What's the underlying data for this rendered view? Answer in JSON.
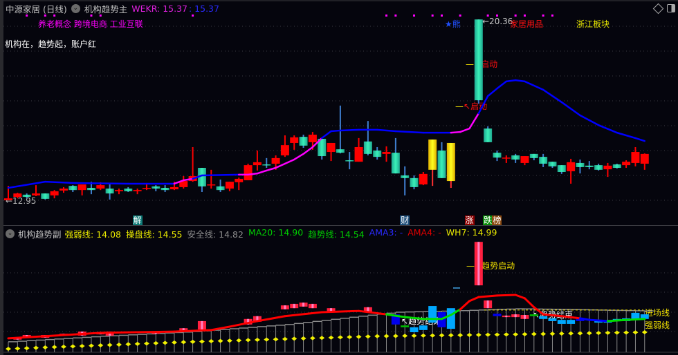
{
  "header": {
    "stock_name": "中源家居 (日线)",
    "main_indicator": "机构趋势主",
    "wekr_label": "WEKR: 15.37",
    "wekr_value2": ": 15.37",
    "icons": [
      "chevron-circle-icon",
      "diamond-icon",
      "panel-toggle-icon"
    ]
  },
  "concept_tags": "养老概念 跨境电商 工业互联",
  "slogan": "机构在，趋势起，账户红",
  "annotations": {
    "low_price": "←12.95",
    "high_price": "←20.36",
    "bear": "★熊",
    "industry": "家居用品",
    "region": "浙江板块",
    "start1": "启动",
    "start2": "启动"
  },
  "event_badges": [
    {
      "text": "解",
      "index": 14,
      "color": "#0d7a77"
    },
    {
      "text": "财",
      "index": 43,
      "color": "#1d4e7a"
    },
    {
      "text": "涨",
      "index": 50,
      "color": "#8b0000"
    },
    {
      "text": "跌",
      "index": 52,
      "color": "#0a8a0a"
    },
    {
      "text": "榜",
      "index": 53,
      "color": "#8b4a10"
    }
  ],
  "sub_header": {
    "name": "机构趋势副",
    "items": [
      {
        "label": "强弱线: 14.08",
        "color": "#e8e800"
      },
      {
        "label": "操盘线: 14.55",
        "color": "#e8e800"
      },
      {
        "label": "安全线: 14.82",
        "color": "#8c8c8c"
      },
      {
        "label": "MA20: 14.90",
        "color": "#00d000"
      },
      {
        "label": "趋势线: 14.54",
        "color": "#00d000"
      },
      {
        "label": "AMA3: -",
        "color": "#2a2aff"
      },
      {
        "label": "AMA4: -",
        "color": "#e00000"
      },
      {
        "label": "WH7: 14.99",
        "color": "#e8e800"
      }
    ]
  },
  "sub_annotations": {
    "trend_start": "趋势启动",
    "trend_end1": "趋势结束",
    "trend_end2": "趋势结束",
    "entry_line": "进场线",
    "strength_line": "强弱线"
  },
  "colors": {
    "up": "#ff0000",
    "down": "#2ee8b0",
    "special": "#f0e000",
    "ma": "#0000ff",
    "ma_rise": "#ff00ff"
  },
  "chart_data": {
    "type": "candlestick",
    "yellow_indices": [
      46,
      48
    ],
    "signal_dots": [
      2,
      4,
      5,
      9,
      10,
      20,
      41,
      42,
      44,
      46,
      47,
      49,
      52,
      53,
      55,
      56,
      58,
      59
    ],
    "candles": [
      [
        12.95,
        13.54,
        12.95,
        13.03
      ],
      [
        13.09,
        13.26,
        13.03,
        13.23
      ],
      [
        13.18,
        13.23,
        13.03,
        13.09
      ],
      [
        13.15,
        13.57,
        13.12,
        13.23
      ],
      [
        13.23,
        13.23,
        12.98,
        13.01
      ],
      [
        13.15,
        13.37,
        13.03,
        13.32
      ],
      [
        13.35,
        13.49,
        13.26,
        13.43
      ],
      [
        13.54,
        13.57,
        13.29,
        13.37
      ],
      [
        13.37,
        13.6,
        13.15,
        13.6
      ],
      [
        13.46,
        13.71,
        13.2,
        13.37
      ],
      [
        13.43,
        13.69,
        13.37,
        13.57
      ],
      [
        13.43,
        13.6,
        12.98,
        13.23
      ],
      [
        13.32,
        13.43,
        13.2,
        13.37
      ],
      [
        13.43,
        13.49,
        13.29,
        13.32
      ],
      [
        13.32,
        13.43,
        13.2,
        13.37
      ],
      [
        13.43,
        13.66,
        13.37,
        13.46
      ],
      [
        13.52,
        13.57,
        13.32,
        13.43
      ],
      [
        13.46,
        13.57,
        13.29,
        13.37
      ],
      [
        13.4,
        13.71,
        13.37,
        13.49
      ],
      [
        13.49,
        13.94,
        13.43,
        13.74
      ],
      [
        13.74,
        15.13,
        13.71,
        13.94
      ],
      [
        14.28,
        14.28,
        13.29,
        13.52
      ],
      [
        13.57,
        14.2,
        13.43,
        13.6
      ],
      [
        13.52,
        13.8,
        13.29,
        13.37
      ],
      [
        13.43,
        13.71,
        13.32,
        13.71
      ],
      [
        13.69,
        13.88,
        13.37,
        13.83
      ],
      [
        13.77,
        14.45,
        13.77,
        14.39
      ],
      [
        14.39,
        14.99,
        14.17,
        14.51
      ],
      [
        14.42,
        14.68,
        14.28,
        14.39
      ],
      [
        14.45,
        14.79,
        14.2,
        14.68
      ],
      [
        14.79,
        15.61,
        14.73,
        15.21
      ],
      [
        15.3,
        15.61,
        15.02,
        15.53
      ],
      [
        15.55,
        15.64,
        15.1,
        15.19
      ],
      [
        15.33,
        15.75,
        15.02,
        15.64
      ],
      [
        15.47,
        15.47,
        14.62,
        14.76
      ],
      [
        14.93,
        15.3,
        14.56,
        15.3
      ],
      [
        15.04,
        16.83,
        14.87,
        14.9
      ],
      [
        14.59,
        14.93,
        14.22,
        14.56
      ],
      [
        14.53,
        15.5,
        14.53,
        15.13
      ],
      [
        15.36,
        16.2,
        14.79,
        14.85
      ],
      [
        14.99,
        15.13,
        14.62,
        14.73
      ],
      [
        14.85,
        15.16,
        14.53,
        14.93
      ],
      [
        14.9,
        15.5,
        14.05,
        14.05
      ],
      [
        13.97,
        14.34,
        13.15,
        13.86
      ],
      [
        13.86,
        13.97,
        13.4,
        13.49
      ],
      [
        13.6,
        14.11,
        13.57,
        14.03
      ],
      [
        14.2,
        15.44,
        13.54,
        15.44
      ],
      [
        14.99,
        15.33,
        13.86,
        13.86
      ],
      [
        13.74,
        15.3,
        13.46,
        15.3
      ],
      null,
      null,
      [
        20.36,
        20.36,
        16.91,
        17.05
      ],
      [
        15.89,
        15.98,
        15.33,
        15.33
      ],
      [
        14.9,
        14.99,
        14.56,
        14.7
      ],
      [
        14.68,
        14.79,
        14.48,
        14.7
      ],
      [
        14.79,
        14.85,
        14.48,
        14.62
      ],
      [
        14.48,
        14.76,
        14.39,
        14.76
      ],
      [
        14.85,
        14.85,
        14.59,
        14.68
      ],
      [
        14.73,
        14.85,
        14.31,
        14.45
      ],
      [
        14.53,
        14.53,
        14.28,
        14.34
      ],
      [
        14.39,
        14.39,
        14.03,
        14.11
      ],
      [
        14.14,
        14.65,
        13.63,
        14.51
      ],
      [
        14.48,
        14.62,
        14.05,
        14.31
      ],
      [
        14.37,
        14.56,
        14.22,
        14.31
      ],
      [
        14.39,
        14.45,
        14.17,
        14.2
      ],
      [
        14.22,
        14.48,
        13.91,
        14.37
      ],
      [
        14.42,
        14.45,
        14.25,
        14.28
      ],
      [
        14.39,
        14.59,
        14.28,
        14.53
      ],
      [
        14.48,
        15.13,
        14.34,
        14.93
      ],
      [
        14.45,
        14.87,
        14.2,
        14.85
      ]
    ],
    "ma_line": [
      [
        0,
        13.46,
        "ma"
      ],
      [
        4,
        13.71,
        "ma"
      ],
      [
        7,
        13.66,
        "ma"
      ],
      [
        13,
        13.63,
        "ma"
      ],
      [
        18,
        13.63,
        "ma"
      ],
      [
        19,
        13.77,
        "ma_rise"
      ],
      [
        20,
        13.83,
        "ma_rise"
      ],
      [
        21,
        13.97,
        "ma"
      ],
      [
        25,
        14.0,
        "ma"
      ],
      [
        26,
        14.0,
        "ma_rise"
      ],
      [
        27,
        14.05,
        "ma_rise"
      ],
      [
        28,
        14.17,
        "ma_rise"
      ],
      [
        29,
        14.28,
        "ma_rise"
      ],
      [
        30,
        14.45,
        "ma_rise"
      ],
      [
        31,
        14.62,
        "ma_rise"
      ],
      [
        32,
        14.85,
        "ma_rise"
      ],
      [
        33,
        15.13,
        "ma_rise"
      ],
      [
        34,
        15.5,
        "ma_rise"
      ],
      [
        35,
        15.78,
        "ma"
      ],
      [
        36,
        15.81,
        "ma"
      ],
      [
        38,
        15.84,
        "ma"
      ],
      [
        40,
        15.84,
        "ma"
      ],
      [
        42,
        15.78,
        "ma"
      ],
      [
        45,
        15.72,
        "ma"
      ],
      [
        48,
        15.72,
        "ma"
      ],
      [
        49,
        15.75,
        "ma_rise"
      ],
      [
        50,
        15.89,
        "ma_rise"
      ],
      [
        51,
        16.51,
        "ma_rise"
      ],
      [
        52,
        17.22,
        "ma"
      ],
      [
        53,
        17.53,
        "ma"
      ],
      [
        54,
        17.82,
        "ma"
      ],
      [
        55,
        17.87,
        "ma"
      ],
      [
        56,
        17.82,
        "ma"
      ],
      [
        58,
        17.48,
        "ma"
      ],
      [
        60,
        16.97,
        "ma"
      ],
      [
        62,
        16.43,
        "ma"
      ],
      [
        64,
        16.03,
        "ma"
      ],
      [
        66,
        15.72,
        "ma"
      ],
      [
        68,
        15.5,
        "ma"
      ],
      [
        69,
        15.38,
        "ma"
      ]
    ],
    "sub_trend_line": [
      [
        0,
        13.88,
        "#ff0000"
      ],
      [
        4,
        13.95,
        "#ff0000"
      ],
      [
        10,
        14.06,
        "#ff0000"
      ],
      [
        18,
        14.1,
        "#ff0000"
      ],
      [
        22,
        14.15,
        "#ff0000"
      ],
      [
        24,
        14.26,
        "#ff0000"
      ],
      [
        27,
        14.44,
        "#ff0000"
      ],
      [
        30,
        14.6,
        "#ff0000"
      ],
      [
        34,
        14.73,
        "#ff0000"
      ],
      [
        38,
        14.77,
        "#ff0000"
      ],
      [
        41,
        14.66,
        "#ff0000"
      ],
      [
        43,
        14.57,
        "#00dd00"
      ],
      [
        45,
        14.51,
        "#00dd00"
      ],
      [
        47,
        14.51,
        "#00dd00"
      ],
      [
        48,
        14.64,
        "#00dd00"
      ],
      [
        49,
        14.82,
        "#00dd00"
      ],
      [
        50,
        15.09,
        "#ff0000"
      ],
      [
        51,
        15.22,
        "#ff0000"
      ],
      [
        53,
        15.27,
        "#ff0000"
      ],
      [
        55,
        15.29,
        "#ff0000"
      ],
      [
        56,
        15.18,
        "#ff0000"
      ],
      [
        57,
        14.89,
        "#ff0000"
      ],
      [
        58,
        14.66,
        "#ff0000"
      ],
      [
        60,
        14.6,
        "#ff0000"
      ],
      [
        62,
        14.53,
        "#ff0000"
      ],
      [
        63,
        14.48,
        "#0000ff"
      ],
      [
        65,
        14.44,
        "#0000ff"
      ],
      [
        66,
        14.46,
        "#00dd00"
      ],
      [
        69,
        14.51,
        "#00dd00"
      ]
    ],
    "safety_line": [
      [
        0,
        13.77
      ],
      [
        10,
        13.95
      ],
      [
        20,
        14.1
      ],
      [
        30,
        14.33
      ],
      [
        38,
        14.6
      ],
      [
        42,
        14.73
      ],
      [
        48,
        14.77
      ],
      [
        55,
        14.84
      ],
      [
        60,
        14.82
      ],
      [
        69,
        14.77
      ]
    ],
    "strength_line": [
      [
        0,
        13.54
      ],
      [
        20,
        13.77
      ],
      [
        40,
        13.95
      ],
      [
        55,
        14.01
      ],
      [
        69,
        14.08
      ]
    ],
    "entry_line_value": 14.8,
    "sub_bars": [
      [
        1,
        13.9,
        13.84,
        "#ff2040"
      ],
      [
        2,
        13.99,
        13.93,
        "#ff2040"
      ],
      [
        4,
        13.99,
        13.9,
        "#ff2040"
      ],
      [
        6,
        14.03,
        13.99,
        "#ff2040"
      ],
      [
        8,
        14.1,
        13.97,
        "#ff2040"
      ],
      [
        10,
        14.06,
        14.01,
        "#ff2040"
      ],
      [
        11,
        14.1,
        13.97,
        "#ff2040"
      ],
      [
        16,
        14.1,
        14.03,
        "#ff2040"
      ],
      [
        19,
        14.21,
        14.1,
        "#ff2040"
      ],
      [
        21,
        14.44,
        14.17,
        "#ff2040"
      ],
      [
        26,
        14.51,
        14.33,
        "#ff2040"
      ],
      [
        27,
        14.6,
        14.42,
        "#ff2040"
      ],
      [
        30,
        14.95,
        14.82,
        "#ff2040"
      ],
      [
        31,
        15.0,
        14.86,
        "#ff2040"
      ],
      [
        32,
        15.04,
        14.91,
        "#ff2040"
      ],
      [
        33,
        15.0,
        14.86,
        "#ff2040"
      ],
      [
        35,
        14.86,
        14.73,
        "#ff2040"
      ],
      [
        39,
        14.89,
        14.73,
        "#ff2040"
      ],
      [
        42,
        14.66,
        14.33,
        "#0000ee"
      ],
      [
        43,
        14.3,
        14.24,
        "#00bb00"
      ],
      [
        44,
        14.24,
        14.08,
        "#00a8ff"
      ],
      [
        45,
        14.3,
        14.15,
        "#00a8ff"
      ],
      [
        46,
        14.93,
        14.39,
        "#00a8ff"
      ],
      [
        47,
        14.73,
        14.24,
        "#0000ee"
      ],
      [
        48,
        14.86,
        14.19,
        "#00a8ff"
      ],
      [
        51,
        17.01,
        15.6,
        "#ff2040"
      ],
      [
        52,
        15.11,
        14.86,
        "#ff2040"
      ],
      [
        53,
        14.68,
        14.6,
        "#0000ee"
      ],
      [
        54,
        14.62,
        14.57,
        "#ff2040"
      ],
      [
        55,
        14.66,
        14.57,
        "#ff2040"
      ],
      [
        56,
        14.64,
        14.51,
        "#ff2040"
      ],
      [
        57,
        14.66,
        14.6,
        "#00bb00"
      ],
      [
        58,
        14.6,
        14.51,
        "#00a8ff"
      ],
      [
        59,
        14.53,
        14.44,
        "#00a8ff"
      ],
      [
        60,
        14.48,
        14.35,
        "#00a8ff"
      ],
      [
        61,
        14.48,
        14.35,
        "#00a8ff"
      ],
      [
        62,
        14.53,
        14.44,
        "#0000ee"
      ],
      [
        64,
        14.48,
        14.39,
        "#00a8ff"
      ],
      [
        65,
        14.44,
        14.39,
        "#00a8ff"
      ],
      [
        66,
        14.51,
        14.44,
        "#00a8ff"
      ],
      [
        67,
        14.53,
        14.44,
        "#00a8ff"
      ],
      [
        68,
        14.71,
        14.51,
        "#00a8ff"
      ],
      [
        69,
        14.66,
        14.51,
        "#00a8ff"
      ]
    ]
  }
}
